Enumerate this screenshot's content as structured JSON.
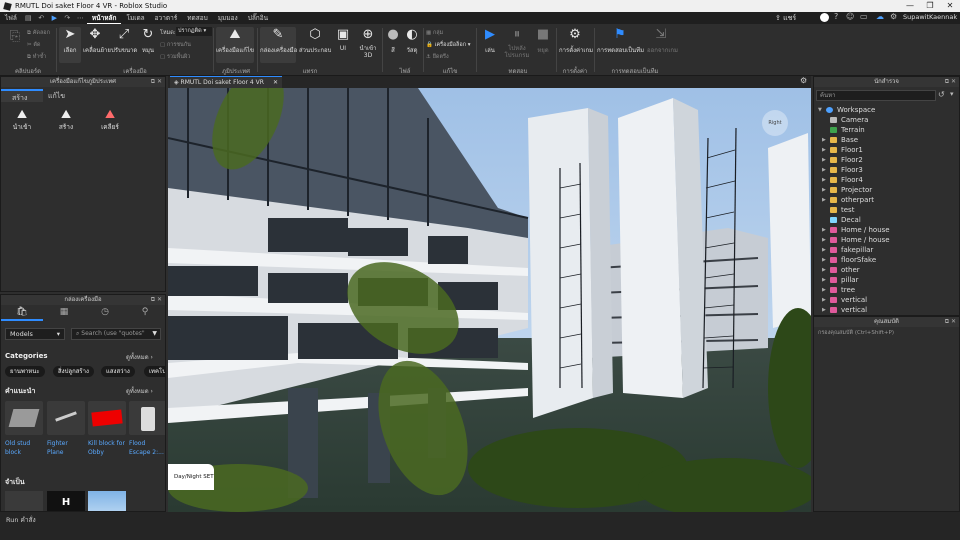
{
  "window": {
    "title": "RMUTL Doi saket Floor  4 VR - Roblox Studio",
    "controls": [
      "—",
      "❐",
      "✕"
    ]
  },
  "menubar": {
    "file": "ไฟล์",
    "tabs": [
      "หน้าหลัก",
      "โมเดล",
      "อวาตาร์",
      "ทดสอบ",
      "มุมมอง",
      "ปลั๊กอิน"
    ],
    "share": "แชร์",
    "user": "SupawitKaennak"
  },
  "ribbon": {
    "clipboard": {
      "paste": "ติดตั้ง",
      "copy": "คัดลอก",
      "cut": "ตัด",
      "duplicate": "ทำซ้ำ",
      "group": "คลิปบอร์ด"
    },
    "tools": {
      "select": "เลือก",
      "move": "เคลื่อนย้าย",
      "scale": "ปรับขนาด",
      "rotate": "หมุน",
      "mode_label": "โหมด:",
      "mode_value": "ปรากฏติด",
      "collide": "การชนกัน",
      "join": "รวมพื้นผิว",
      "group": "เครื่องมือ"
    },
    "terrain": {
      "editor": "เครื่องมือแก้ไข",
      "group": "ภูมิประเทศ"
    },
    "insert": {
      "toolbox": "กล่องเครื่องมือ",
      "part": "ส่วนประกอบ",
      "ui": "UI",
      "import3d": "นำเข้า 3D",
      "group": "แทรก"
    },
    "file": {
      "color": "สี",
      "material": "วัสดุ",
      "group": "ไฟล์"
    },
    "edit": {
      "group_btn": "กลุ่ม",
      "lock": "ล็อก",
      "anchor": "ยึดตรึง",
      "tools_label": "เครื่องมือล็อก",
      "group": "แก้ไข"
    },
    "test": {
      "play": "เล่น",
      "resume": "ไปหลังโปรแกรม",
      "stop": "หยุด",
      "group": "ทดสอบ"
    },
    "settings": {
      "game_settings": "การตั้งค่าเกม",
      "group": "การตั้งค่า"
    },
    "team": {
      "team_test": "การทดสอบเป็นทีม",
      "exit": "ออกจากเกม",
      "group": "การทดสอบเป็นทีม"
    }
  },
  "terrain_panel": {
    "header": "เครื่องมือแก้ไขภูมิประเทศ",
    "tabs": [
      "สร้าง",
      "แก้ไข"
    ],
    "tools": [
      "นำเข้า",
      "สร้าง",
      "เคลียร์"
    ]
  },
  "toolbox": {
    "header": "กล่องเครื่องมือ",
    "dropdown": "Models",
    "search_placeholder": "Search (use \"quotes\"",
    "categories_label": "Categories",
    "see_all": "ดูทั้งหมด",
    "chips": [
      "ยานพาหนะ",
      "สิ่งปลูกสร้าง",
      "แสงสว่าง",
      "เทคโน"
    ],
    "recommended_label": "คำแนะนำ",
    "cards": [
      {
        "label": "Old stud block"
      },
      {
        "label": "Fighter Plane"
      },
      {
        "label": "Kill block for Obby"
      },
      {
        "label": "Flood Escape 2:..."
      }
    ],
    "essentials_label": "จำเป็น"
  },
  "viewport": {
    "tab_title": "RMUTL Doi saket Floor  4 VR",
    "tab_close": "✕",
    "daynight_label": "Day/Night SET",
    "view_cube_label": "Right"
  },
  "explorer": {
    "header": "นักสำรวจ",
    "filter_placeholder": "ค้นหา",
    "items": [
      {
        "label": "Workspace",
        "color": "#4ea1ff",
        "expanded": true,
        "level": 0
      },
      {
        "label": "Camera",
        "color": "#bbbbbb",
        "level": 1
      },
      {
        "label": "Terrain",
        "color": "#3fa34d",
        "level": 1
      },
      {
        "label": "Base",
        "color": "#e7b74a",
        "level": 1
      },
      {
        "label": "Floor1",
        "color": "#e7b74a",
        "level": 1
      },
      {
        "label": "Floor2",
        "color": "#e7b74a",
        "level": 1
      },
      {
        "label": "Floor3",
        "color": "#e7b74a",
        "level": 1
      },
      {
        "label": "Floor4",
        "color": "#e7b74a",
        "level": 1
      },
      {
        "label": "Projector",
        "color": "#e7b74a",
        "level": 1
      },
      {
        "label": "otherpart",
        "color": "#e7b74a",
        "level": 1
      },
      {
        "label": "test",
        "color": "#e7b74a",
        "level": 1
      },
      {
        "label": "Decal",
        "color": "#7fd6ff",
        "level": 1
      },
      {
        "label": "Home / house",
        "color": "#e05a9c",
        "level": 1
      },
      {
        "label": "Home / house",
        "color": "#e05a9c",
        "level": 1
      },
      {
        "label": "fakepillar",
        "color": "#e05a9c",
        "level": 1
      },
      {
        "label": "floorSfake",
        "color": "#e05a9c",
        "level": 1
      },
      {
        "label": "other",
        "color": "#e05a9c",
        "level": 1
      },
      {
        "label": "pillar",
        "color": "#e05a9c",
        "level": 1
      },
      {
        "label": "tree",
        "color": "#e05a9c",
        "level": 1
      },
      {
        "label": "vertical",
        "color": "#e05a9c",
        "level": 1
      },
      {
        "label": "vertical",
        "color": "#e05a9c",
        "level": 1
      }
    ]
  },
  "properties": {
    "header": "คุณสมบัติ",
    "filter_placeholder": "กรองคุณสมบัติ (Ctrl+Shift+P)"
  },
  "statusbar": {
    "text": "Run  คำสั่ง"
  }
}
